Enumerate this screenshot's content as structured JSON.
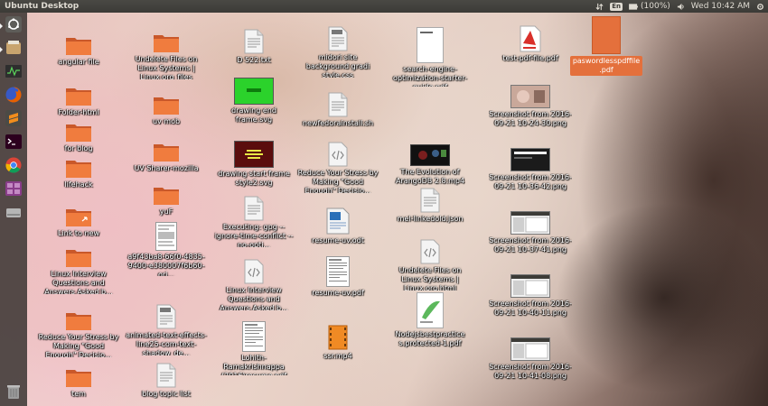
{
  "topbar": {
    "title": "Ubuntu Desktop",
    "lang": "En",
    "battery": "(100%)",
    "clock": "Wed 10:42 AM"
  },
  "launcher": [
    {
      "name": "launcher-dash-icon",
      "icon": "ubuntu-logo",
      "color": "#555"
    },
    {
      "name": "launcher-files-icon",
      "icon": "files",
      "color": "#c8a46e"
    },
    {
      "name": "launcher-monitor-icon",
      "icon": "system-monitor",
      "color": "#3a3a3a"
    },
    {
      "name": "launcher-firefox-icon",
      "icon": "firefox",
      "color": "#e66000"
    },
    {
      "name": "launcher-sublime-icon",
      "icon": "sublime-text",
      "color": "#f28e1c"
    },
    {
      "name": "launcher-terminal-icon",
      "icon": "terminal",
      "color": "#2c001e"
    },
    {
      "name": "launcher-chrome-icon",
      "icon": "chrome",
      "color": "#4285f4"
    },
    {
      "name": "launcher-workspaces-icon",
      "icon": "workspace-switcher",
      "color": "#8a3d8a"
    },
    {
      "name": "launcher-drive-icon",
      "icon": "removable-drive",
      "color": "#aaa"
    },
    {
      "name": "launcher-trash-icon",
      "icon": "trash",
      "color": "#999"
    }
  ],
  "desktop": {
    "items": [
      {
        "label": "angular file",
        "icon": "folder"
      },
      {
        "label": "Folder-html",
        "icon": "folder"
      },
      {
        "label": "for blog",
        "icon": "folder"
      },
      {
        "label": "lifehack",
        "icon": "folder"
      },
      {
        "label": "Link to new",
        "icon": "folder-link"
      },
      {
        "label": "Linux Interview Questions and Answers Asked b...",
        "icon": "folder"
      },
      {
        "label": "Reduce Your Stress by Making \"Good Enough\" Decisio...",
        "icon": "folder"
      },
      {
        "label": "tem",
        "icon": "folder"
      },
      {
        "label": "Undelete Files on Linux Systems | Linux.org_files",
        "icon": "folder"
      },
      {
        "label": "uv mob",
        "icon": "folder"
      },
      {
        "label": "UV Sharer-mozilla",
        "icon": "folder"
      },
      {
        "label": "yuF",
        "icon": "folder"
      },
      {
        "label": "a9f43ba8-66f0-4835-9400-e380007f6b60-ori...",
        "icon": "image-doc"
      },
      {
        "label": "animated-text-effects-line25-com-text-shadow_de...",
        "icon": "css"
      },
      {
        "label": "blog topic list",
        "icon": "text"
      },
      {
        "label": "D 522.txt",
        "icon": "text"
      },
      {
        "label": "drawing end frame.svg",
        "icon": "svg-green"
      },
      {
        "label": "drawing start frame style2.svg",
        "icon": "svg-dark"
      },
      {
        "label": "Executing: gpg --ignore-time-conflict --no-opti...",
        "icon": "text"
      },
      {
        "label": "Linux Interview Questions and Answers Asked b...",
        "icon": "html"
      },
      {
        "label": "Lohith-Ramakrishnappa (2016)resume.pdf",
        "icon": "pdf-doc"
      },
      {
        "label": "midori site background gradi style.css",
        "icon": "css"
      },
      {
        "label": "newfedorainstall.sh",
        "icon": "text"
      },
      {
        "label": "Reduce Your Stress by Making \"Good Enough\" Decisio...",
        "icon": "html"
      },
      {
        "label": "resume-uv.odt",
        "icon": "odt"
      },
      {
        "label": "resume-uv.pdf",
        "icon": "pdf-doc"
      },
      {
        "label": "ssr.mp4",
        "icon": "video"
      },
      {
        "label": "search-engine-optimization-starter-guide.pdf",
        "icon": "pdf-white"
      },
      {
        "label": "The Evolution of ArangoDB 2.8.mp4",
        "icon": "video-thumb"
      },
      {
        "label": "mel-linkedold.json",
        "icon": "text"
      },
      {
        "label": "Undelete Files on Linux Systems | Linux.org.html",
        "icon": "html"
      },
      {
        "label": "Nodejsbestpractice s.protected-1.pdf",
        "icon": "pdf-green"
      },
      {
        "label": "test-pdf-file.pdf",
        "icon": "pdf-red"
      },
      {
        "label": "Screenshot from 2016-09-21 10-24-30.png",
        "icon": "shot-photo"
      },
      {
        "label": "Screenshot from 2016-09-21 10-36-42.png",
        "icon": "shot-dark"
      },
      {
        "label": "Screenshot from 2016-09-21 10-37-41.png",
        "icon": "shot-window"
      },
      {
        "label": "Screenshot from 2016-09-21 10-40-11.png",
        "icon": "shot-window"
      },
      {
        "label": "Screenshot from 2016-09-21 10-41-08.png",
        "icon": "shot-window"
      },
      {
        "label": "paswordlesspdffile.pdf",
        "icon": "pdf-orange",
        "selected": true
      }
    ]
  },
  "colors": {
    "folder": "#f07c3e",
    "selection": "#e4703c",
    "panel": "#3c3b37"
  }
}
